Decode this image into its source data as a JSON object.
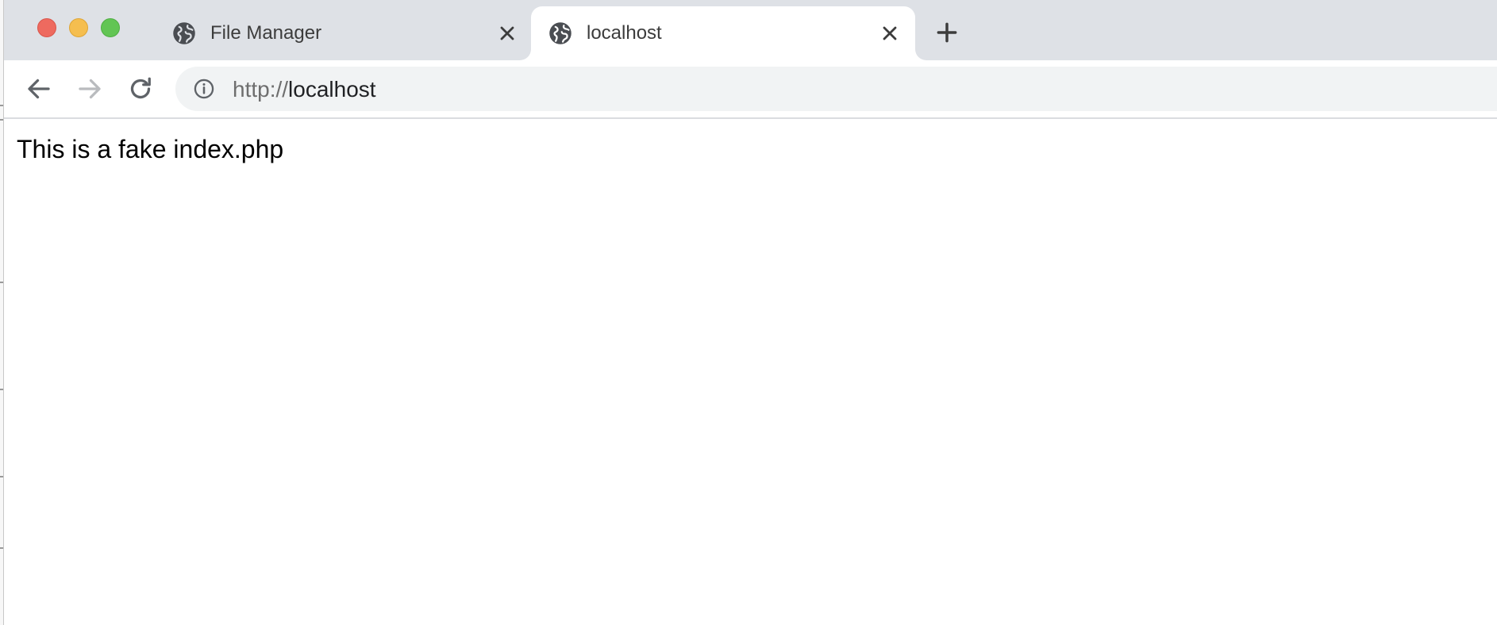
{
  "browser": {
    "tabs": [
      {
        "title": "File Manager",
        "icon": "globe-icon",
        "active": false
      },
      {
        "title": "localhost",
        "icon": "globe-icon",
        "active": true
      }
    ],
    "toolbar": {
      "back_icon": "arrow-left-icon",
      "forward_icon": "arrow-right-icon",
      "reload_icon": "reload-icon"
    },
    "address_bar": {
      "scheme": "http://",
      "host": "localhost",
      "icon": "info-icon"
    }
  },
  "page": {
    "text": "This is a fake index.php"
  },
  "colors": {
    "tabstrip": "#dee1e6",
    "active_tab": "#ffffff",
    "omnibox": "#f1f3f4",
    "close_red": "#ee6a5f",
    "minimize_yellow": "#f5be4f",
    "maximize_green": "#62c554"
  }
}
